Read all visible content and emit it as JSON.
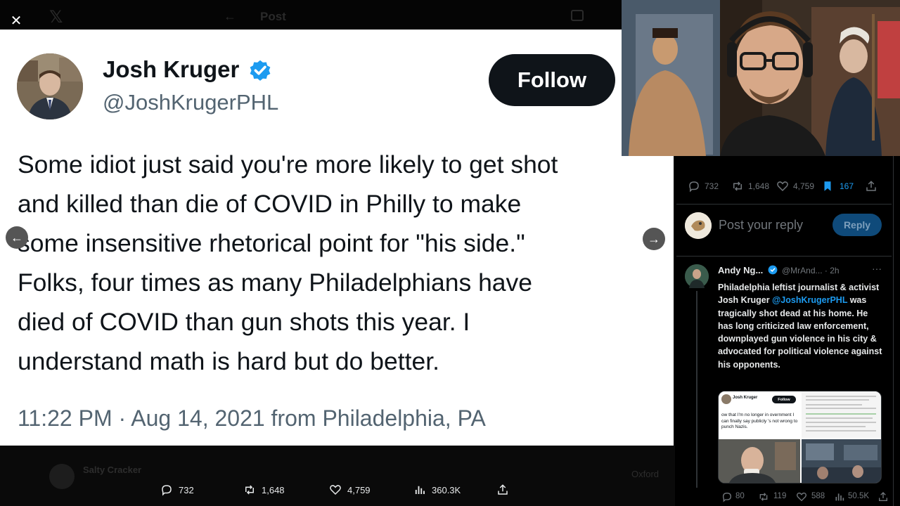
{
  "background": {
    "header_title": "Post",
    "bg_reply_name": "Salty Cracker",
    "bg_reply_right": "Oxford",
    "actions": {
      "replies": "732",
      "reposts": "1,648",
      "likes": "4,759",
      "views": "360.3K"
    }
  },
  "tweet": {
    "author_name": "Josh Kruger",
    "author_handle": "@JoshKrugerPHL",
    "follow_label": "Follow",
    "text": "Some idiot just said you're more likely to get shot\nand killed than die of COVID in Philly to make\nsome insensitive rhetorical point for \"his side.\"\nFolks, four times as many Philadelphians have\ndied of COVID than gun shots this year. I\nunderstand math is hard but do better.",
    "timestamp": "11:22 PM · Aug 14, 2021 from Philadelphia, PA"
  },
  "right_panel": {
    "stats": {
      "replies": "732",
      "reposts": "1,648",
      "likes": "4,759",
      "bookmarks": "167"
    },
    "reply_placeholder": "Post your reply",
    "reply_button": "Reply",
    "quote": {
      "name": "Andy Ng...",
      "meta": "@MrAnd... · 2h",
      "more": "···",
      "text_before": "Philadelphia leftist journalist & activist Josh Kruger ",
      "mention": "@JoshKrugerPHL",
      "text_after": " was tragically shot dead at his home. He has long criticized law enforcement, downplayed gun violence in his city & advocated for political violence against his opponents.",
      "media": {
        "name": "Josh Kruger",
        "follow": "Follow",
        "text": "ow that I'm no longer in overnment I can finally say publicly 's not wrong to punch Nazis."
      },
      "stats": {
        "replies": "80",
        "reposts": "119",
        "likes": "588",
        "views": "50.5K"
      }
    }
  },
  "colors": {
    "verified": "#1d9bf0",
    "follow_bg": "#0f1419",
    "reply_button": "#0f4a7a",
    "mention": "#1d9bf0"
  },
  "icons": [
    "close-icon",
    "x-logo-icon",
    "verified-icon",
    "reply-icon",
    "repost-icon",
    "like-icon",
    "views-icon",
    "share-icon",
    "bookmark-icon",
    "chevron-left-icon",
    "chevron-right-icon"
  ]
}
